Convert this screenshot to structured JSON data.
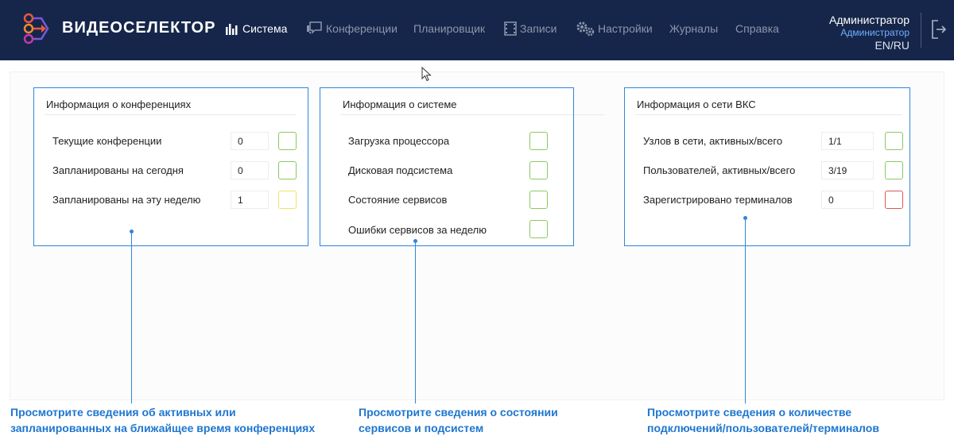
{
  "header": {
    "logo_text": "ВИДЕОСЕЛЕКТОР",
    "nav": [
      {
        "label": "Система",
        "icon": "bar-chart-icon",
        "active": true
      },
      {
        "label": "Конференции",
        "icon": "chat-bubbles-icon"
      },
      {
        "label": "Планировщик",
        "icon": ""
      },
      {
        "label": "Записи",
        "icon": "film-icon"
      },
      {
        "label": "Настройки",
        "icon": "gears-icon"
      },
      {
        "label": "Журналы",
        "icon": ""
      },
      {
        "label": "Справка",
        "icon": ""
      }
    ],
    "user": {
      "name": "Администратор",
      "role": "Администратор",
      "lang": "EN/RU"
    }
  },
  "panels": {
    "conferences": {
      "title": "Информация о конференциях",
      "rows": [
        {
          "label": "Текущие конференции",
          "value": "0",
          "status": "green"
        },
        {
          "label": "Запланированы на сегодня",
          "value": "0",
          "status": "green"
        },
        {
          "label": "Запланированы на эту неделю",
          "value": "1",
          "status": "yellow"
        }
      ]
    },
    "system": {
      "title": "Информация о системе",
      "rows": [
        {
          "label": "Загрузка процессора",
          "status": "green"
        },
        {
          "label": "Дисковая подсистема",
          "status": "green"
        },
        {
          "label": "Состояние сервисов",
          "status": "green"
        },
        {
          "label": "Ошибки сервисов за неделю",
          "status": "green"
        }
      ]
    },
    "network": {
      "title": "Информация о сети ВКС",
      "rows": [
        {
          "label": "Узлов в сети, активных/всего",
          "value": "1/1",
          "status": "green"
        },
        {
          "label": "Пользователей, активных/всего",
          "value": "3/19",
          "status": "green"
        },
        {
          "label": "Зарегистрировано терминалов",
          "value": "0",
          "status": "red"
        }
      ]
    }
  },
  "callouts": {
    "conferences": {
      "line1": "Просмотрите сведения об активных или",
      "line2": "запланированных на ближайщее время конференциях"
    },
    "system": {
      "line1": "Просмотрите сведения о состоянии",
      "line2": "сервисов и подсистем"
    },
    "network": {
      "line1": "Просмотрите сведения о количестве",
      "line2": "подключений/пользователей/терминалов"
    }
  },
  "colors": {
    "header_bg": "#16264a",
    "accent_blue": "#2f86d8",
    "status_green": "#8dc862",
    "status_yellow": "#f0e26a",
    "status_red": "#e05656"
  }
}
